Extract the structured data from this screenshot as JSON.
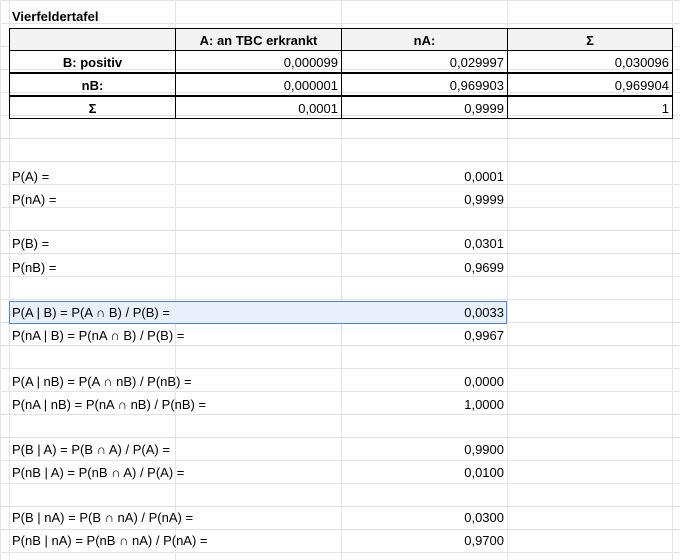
{
  "table": {
    "title": "Vierfeldertafel",
    "headers": [
      "",
      "A: an TBC erkrankt",
      "nA:",
      "Σ"
    ],
    "rows": [
      [
        "B: positiv",
        "0,000099",
        "0,029997",
        "0,030096"
      ],
      [
        "nB:",
        "0,000001",
        "0,969903",
        "0,969904"
      ],
      [
        "Σ",
        "0,0001",
        "0,9999",
        "1"
      ]
    ]
  },
  "calcs": [
    {
      "label": "P(A) =",
      "value": "0,0001"
    },
    {
      "label": "P(nA) =",
      "value": "0,9999"
    },
    {
      "label": "P(B) =",
      "value": "0,0301"
    },
    {
      "label": "P(nB) =",
      "value": "0,9699"
    },
    {
      "label": "P(A | B) = P(A ∩ B) / P(B) =",
      "value": "0,0033"
    },
    {
      "label": "P(nA | B) = P(nA ∩ B) / P(B) =",
      "value": "0,9967"
    },
    {
      "label": "P(A | nB) = P(A ∩ nB) / P(nB) =",
      "value": "0,0000"
    },
    {
      "label": "P(nA | nB) = P(nA ∩ nB) / P(nB) =",
      "value": "1,0000"
    },
    {
      "label": "P(B | A) = P(B ∩ A) / P(A) =",
      "value": "0,9900"
    },
    {
      "label": "P(nB | A) = P(nB ∩ A) / P(A) =",
      "value": "0,0100"
    },
    {
      "label": "P(B | nA) = P(B ∩ nA) / P(nA) =",
      "value": "0,0300"
    },
    {
      "label": "P(nB | nA) = P(nB ∩ nA) / P(nA) =",
      "value": "0,9700"
    }
  ]
}
